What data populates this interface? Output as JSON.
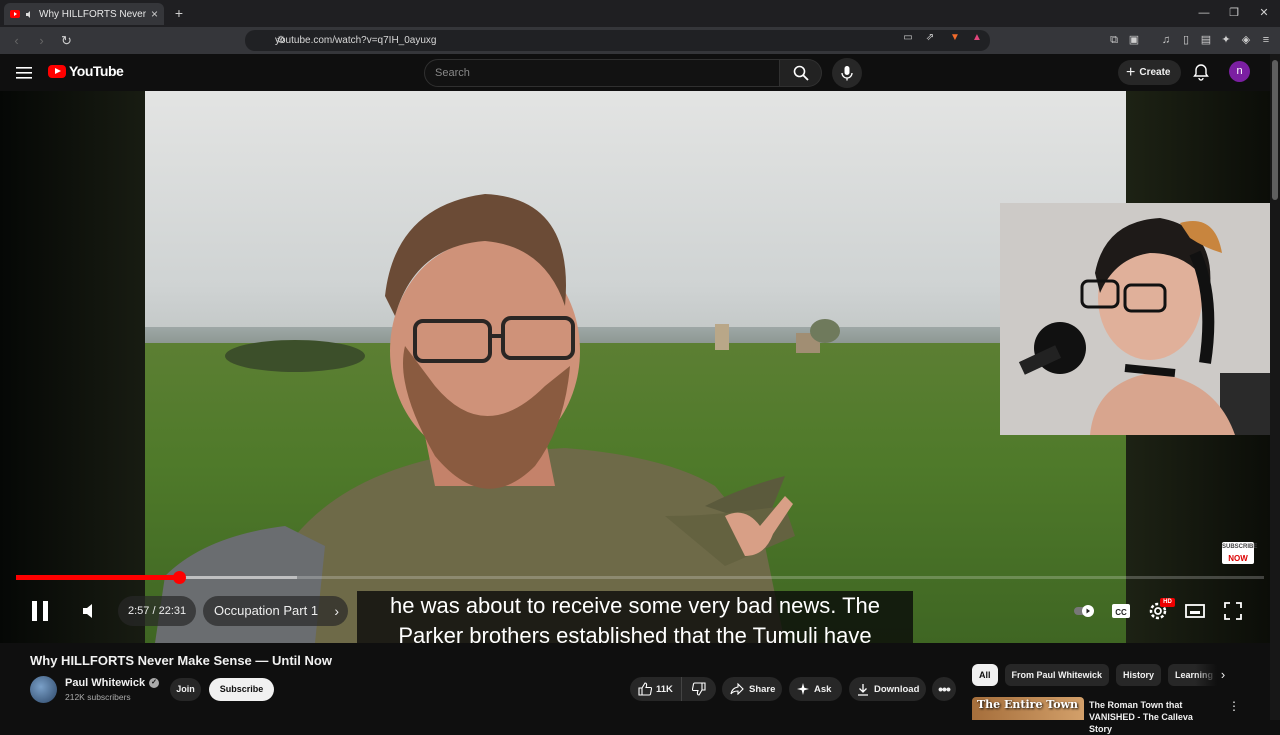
{
  "browser": {
    "tab_title": "Why HILLFORTS Never Make",
    "url": "youtube.com/watch?v=q7IH_0ayuxg",
    "new_tab": "+",
    "close_tab": "×"
  },
  "header": {
    "logo_text": "YouTube",
    "search_placeholder": "Search",
    "create_label": "Create",
    "avatar_letter": "n"
  },
  "player": {
    "caption_line1": "he was about to receive some very bad news. The",
    "caption_line2": "Parker brothers established that the Tumuli have",
    "time": "2:57 / 22:31",
    "chapter": "Occupation Part 1",
    "played_fraction": 0.131,
    "buffered_fraction": 0.225,
    "hd_badge": "HD",
    "subscribe_now_line1": "SUBSCRIBE",
    "subscribe_now_line2": "NOW"
  },
  "video": {
    "title": "Why HILLFORTS Never Make Sense — Until Now"
  },
  "channel": {
    "name": "Paul Whitewick",
    "subscribers": "212K subscribers",
    "join_label": "Join",
    "subscribe_label": "Subscribe"
  },
  "actions": {
    "likes": "11K",
    "share": "Share",
    "ask": "Ask",
    "download": "Download"
  },
  "chips": [
    "All",
    "From Paul Whitewick",
    "History",
    "Learning"
  ],
  "recommended": {
    "thumb_text": "The Entire Town",
    "title": "The Roman Town that VANISHED - The Calleva Story"
  },
  "colors": {
    "accent": "#ff0000",
    "background": "#0f0f0f",
    "avatar": "#7b1fa2"
  }
}
